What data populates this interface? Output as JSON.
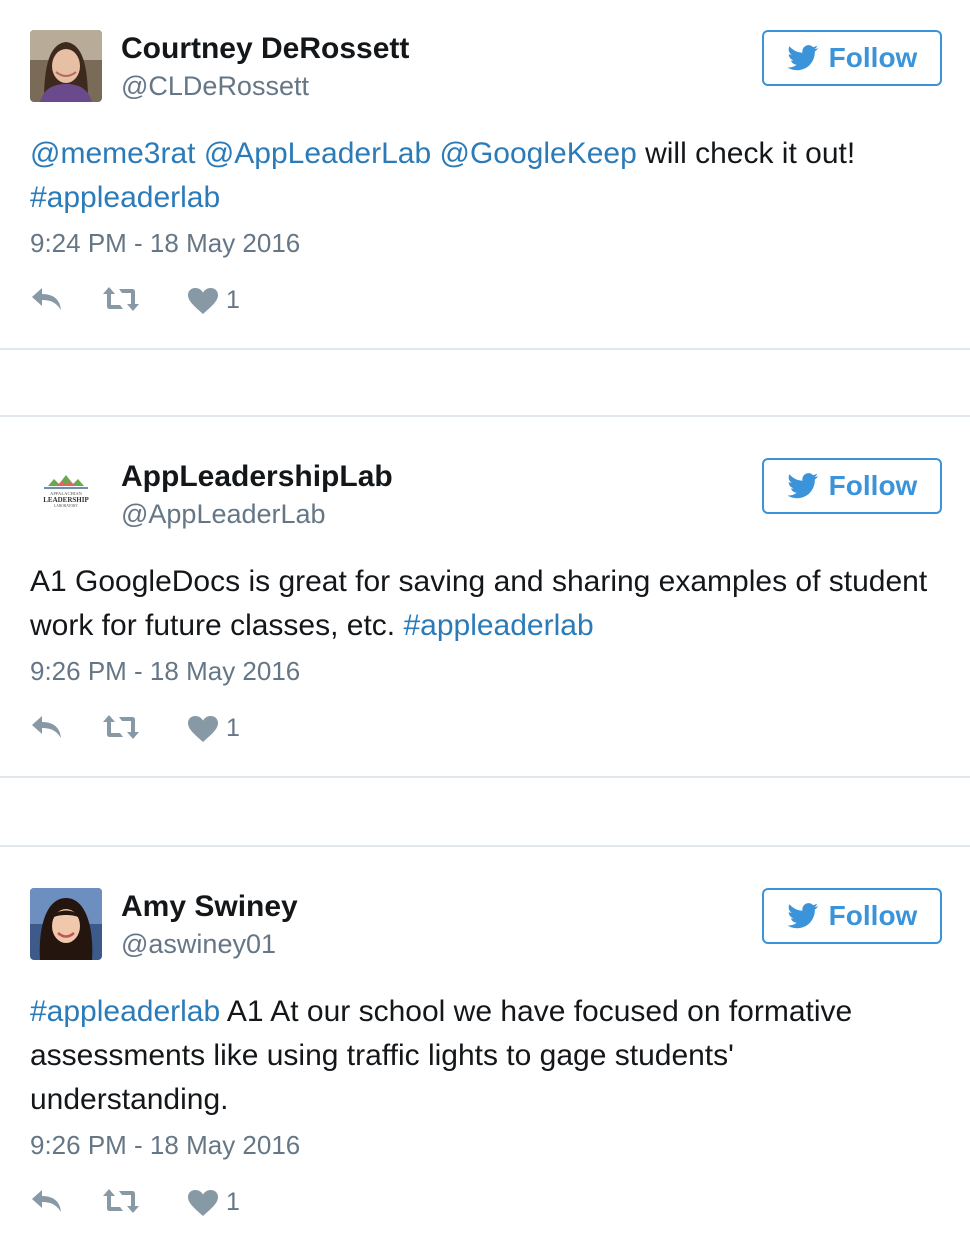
{
  "colors": {
    "accent": "#3b94d9",
    "link": "#2b7bb9",
    "text": "#14171a",
    "meta": "#657786",
    "icon": "#8899a6",
    "divider": "#e1e8ed"
  },
  "follow_label": "Follow",
  "tweets": [
    {
      "name": "Courtney DeRossett",
      "handle": "@CLDeRossett",
      "text": [
        {
          "t": "@meme3rat",
          "link": true
        },
        {
          "t": " ",
          "link": false
        },
        {
          "t": "@AppLeaderLab",
          "link": true
        },
        {
          "t": " ",
          "link": false
        },
        {
          "t": "@GoogleKeep",
          "link": true
        },
        {
          "t": " will check it out! ",
          "link": false
        },
        {
          "t": "#appleaderlab",
          "link": true
        }
      ],
      "timestamp": "9:24 PM - 18 May 2016",
      "likes": "1",
      "icons": [
        "reply-icon",
        "retweet-icon",
        "heart-icon"
      ]
    },
    {
      "name": "AppLeadershipLab",
      "handle": "@AppLeaderLab",
      "avatar_text": [
        "APPALACHIAN",
        "LEADERSHIP",
        "LABORATORY"
      ],
      "text": [
        {
          "t": "A1 GoogleDocs is great for saving and sharing examples of student work for future classes, etc. ",
          "link": false
        },
        {
          "t": "#appleaderlab",
          "link": true
        }
      ],
      "timestamp": "9:26 PM - 18 May 2016",
      "likes": "1",
      "icons": [
        "reply-icon",
        "retweet-icon",
        "heart-icon"
      ]
    },
    {
      "name": "Amy Swiney",
      "handle": "@aswiney01",
      "text": [
        {
          "t": "#appleaderlab",
          "link": true
        },
        {
          "t": " A1 At our school we have focused on formative assessments like using traffic lights to gage students' understanding.",
          "link": false
        }
      ],
      "timestamp": "9:26 PM - 18 May 2016",
      "likes": "1",
      "icons": [
        "reply-icon",
        "retweet-icon",
        "heart-icon"
      ]
    }
  ]
}
